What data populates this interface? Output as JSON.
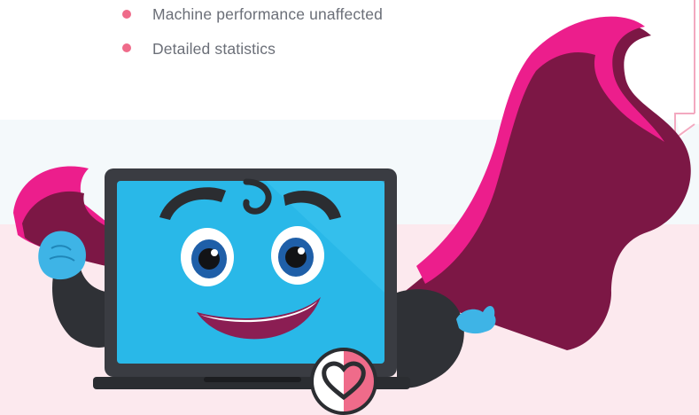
{
  "features": {
    "items": [
      {
        "label": "Machine performance unaffected"
      },
      {
        "label": "Detailed statistics"
      }
    ]
  },
  "colors": {
    "accent_pink": "#ef6b8a",
    "cape_magenta": "#ec1e8c",
    "cape_dark": "#7c1745",
    "screen_blue": "#29b8e8",
    "band_light": "#f4f9fb",
    "band_pink": "#fce9ee",
    "text_gray": "#6b6f78"
  },
  "mascot": {
    "badge_icon": "heart-icon"
  }
}
